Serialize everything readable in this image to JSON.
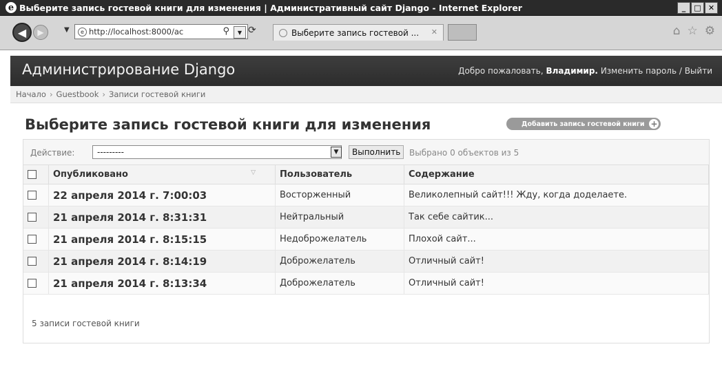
{
  "window": {
    "title": "Выберите запись гостевой книги для изменения | Административный сайт Django - Internet Explorer",
    "min": "_",
    "max": "□",
    "close": "✕"
  },
  "browser": {
    "url": "http://localhost:8000/ac",
    "tab_title": "Выберите запись гостевой ...",
    "tab_close": "✕",
    "icons": [
      "back-arrow-icon",
      "forward-arrow-icon",
      "search-icon",
      "refresh-icon",
      "home-icon",
      "star-icon",
      "gear-icon"
    ]
  },
  "header": {
    "brand": "Администрирование Django",
    "welcome": "Добро пожаловать, ",
    "username": "Владимир.",
    "change_password": "Изменить пароль",
    "sep": " / ",
    "logout": "Выйти"
  },
  "breadcrumbs": {
    "home": "Начало",
    "app": "Guestbook",
    "model": "Записи гостевой книги",
    "sep": "›"
  },
  "content": {
    "title": "Выберите запись гостевой книги для изменения",
    "add_button": "Добавить запись гостевой книги",
    "add_plus": "+"
  },
  "actions": {
    "label": "Действие:",
    "selected": "---------",
    "go": "Выполнить",
    "counter": "Выбрано 0 объектов из 5"
  },
  "table": {
    "headers": [
      "Опубликовано",
      "Пользователь",
      "Содержание"
    ],
    "rows": [
      {
        "date": "22 апреля 2014 г. 7:00:03",
        "user": "Восторженный",
        "content": "Великолепный сайт!!! Жду, когда доделаете."
      },
      {
        "date": "21 апреля 2014 г. 8:31:31",
        "user": "Нейтральный",
        "content": "Так себе сайтик..."
      },
      {
        "date": "21 апреля 2014 г. 8:15:15",
        "user": "Недоброжелатель",
        "content": "Плохой сайт..."
      },
      {
        "date": "21 апреля 2014 г. 8:14:19",
        "user": "Доброжелатель",
        "content": "Отличный сайт!"
      },
      {
        "date": "21 апреля 2014 г. 8:13:34",
        "user": "Доброжелатель",
        "content": "Отличный сайт!"
      }
    ]
  },
  "paginator": "5 записи гостевой книги"
}
